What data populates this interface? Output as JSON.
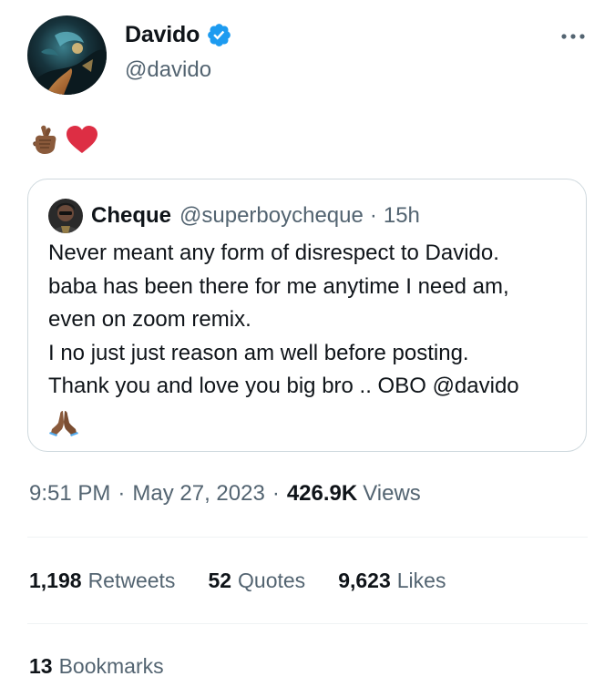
{
  "author": {
    "display_name": "Davido",
    "handle": "@davido",
    "verified_icon": "verified-badge-icon",
    "avatar_icon": "avatar-image"
  },
  "tweet": {
    "emojis": [
      "crossed-fingers-emoji-medium-dark",
      "red-heart-emoji"
    ]
  },
  "quoted_tweet": {
    "display_name": "Cheque",
    "handle": "@superboycheque",
    "dot": "·",
    "time": "15h",
    "text_lines": [
      "Never meant any form of disrespect to Davido.",
      "baba has been there for me anytime I need am,",
      "even on zoom remix.",
      "I no just just reason am well before posting.",
      "Thank you and love you big bro .. OBO @davido"
    ],
    "trailing_emoji": "folded-hands-emoji-medium-dark"
  },
  "meta": {
    "time": "9:51 PM",
    "sep1": "·",
    "date": "May 27, 2023",
    "sep2": "·",
    "views_count": "426.9K",
    "views_label": "Views"
  },
  "stats": {
    "retweets_count": "1,198",
    "retweets_label": "Retweets",
    "quotes_count": "52",
    "quotes_label": "Quotes",
    "likes_count": "9,623",
    "likes_label": "Likes"
  },
  "bookmarks": {
    "count": "13",
    "label": "Bookmarks"
  },
  "colors": {
    "text_primary": "#0f1419",
    "text_secondary": "#536471",
    "border": "#cfd9de",
    "divider": "#eff3f4",
    "verified_blue": "#1d9bf0",
    "heart_red": "#dd2e44"
  }
}
